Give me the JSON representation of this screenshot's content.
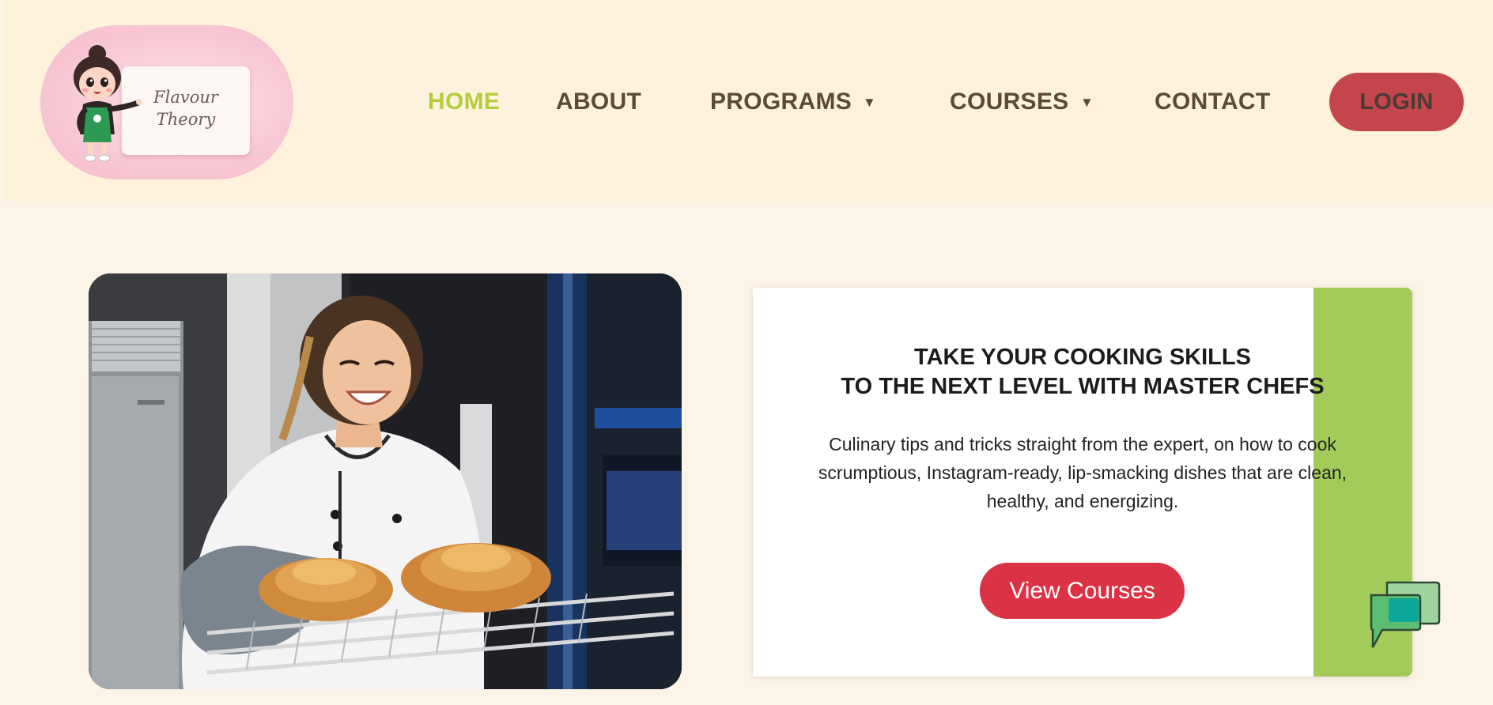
{
  "brand": {
    "logo_line1": "Flavour",
    "logo_line2": "Theory"
  },
  "nav": {
    "home": "HOME",
    "about": "ABOUT",
    "programs": "PROGRAMS",
    "courses": "COURSES",
    "contact": "CONTACT",
    "login": "LOGIN",
    "caret": "▼"
  },
  "hero": {
    "title_line1": "TAKE YOUR COOKING SKILLS",
    "title_line2": "TO THE NEXT LEVEL WITH MASTER CHEFS",
    "body_line1": "Culinary tips and tricks straight from the expert, on how to cook",
    "body_line2": "scrumptious, Instagram-ready, lip-smacking dishes that are clean,",
    "body_line3": "healthy, and energizing.",
    "cta": "View Courses"
  },
  "colors": {
    "header_bg": "#fef2dc",
    "page_bg": "#fdf4e8",
    "nav_text": "#5b4a3a",
    "nav_active": "#b5cd3d",
    "login_bg": "#c4454b",
    "cta_bg": "#dc3245",
    "stripe": "#a3cb5a"
  },
  "icons": {
    "logo": "chef-mascot-logo",
    "chat": "chat-bubbles-icon"
  }
}
